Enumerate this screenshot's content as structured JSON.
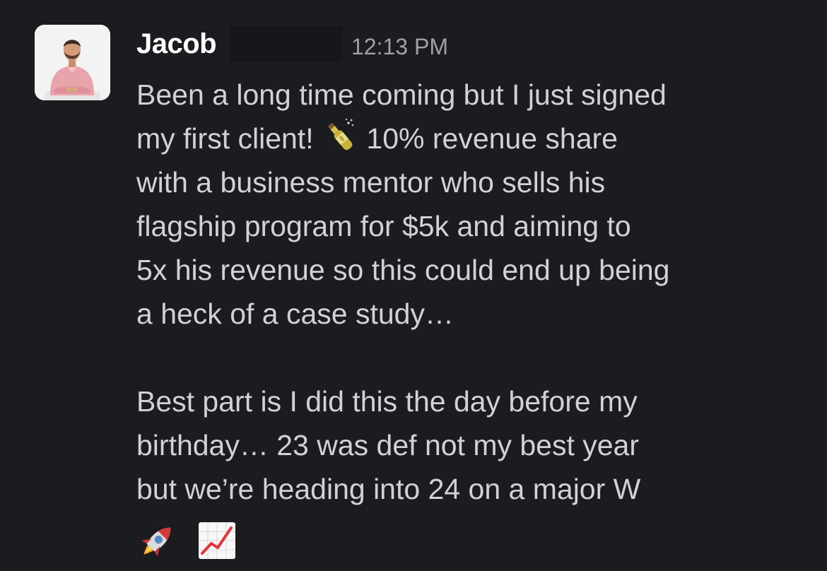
{
  "message": {
    "sender": "Jacob",
    "timestamp": "12:13 PM",
    "avatar_icon": "profile-photo",
    "paragraph1": {
      "line1": "Been a long time coming but I just signed",
      "line2_before": "my first client!",
      "line2_emoji": "champagne-bottle-icon",
      "line2_after": "10% revenue share",
      "line3": "with a business mentor who sells his",
      "line4": "flagship program for $5k and aiming to",
      "line5": "5x his revenue so this could end up being",
      "line6": "a heck of a case study…"
    },
    "paragraph2": {
      "line1": "Best part is I did this the day before my",
      "line2": "birthday… 23 was def not my best year",
      "line3": "but we’re heading into 24 on a major W"
    },
    "trailing_emojis": [
      "rocket-icon",
      "chart-increasing-icon"
    ]
  },
  "colors": {
    "background": "#1b1c20",
    "text": "#d1d2d3",
    "sender": "#ffffff",
    "timestamp": "#a0a1a4"
  }
}
